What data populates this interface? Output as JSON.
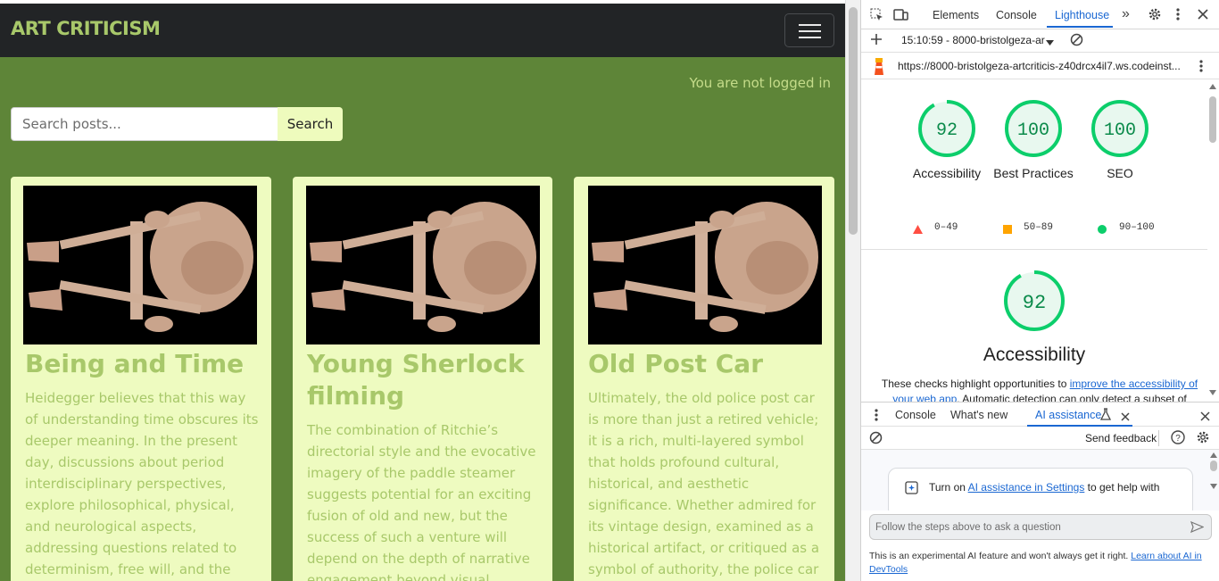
{
  "site": {
    "brand": "ART CRITICISM",
    "login_status": "You are not logged in",
    "search": {
      "placeholder": "Search posts...",
      "button": "Search"
    },
    "posts": [
      {
        "title": "Being and Time",
        "excerpt": "Heidegger believes that this way of understanding time obscures its deeper meaning. In the present day, discussions about period interdisciplinary perspectives, explore philosophical, physical, and neurological aspects, addressing questions related to determinism, free will, and the nature of temporal"
      },
      {
        "title": "Young Sherlock filming",
        "excerpt": "The combination of Ritchie’s directorial style and the evocative imagery of the paddle steamer suggests potential for an exciting fusion of old and new, but the success of such a venture will depend on the depth of narrative engagement beyond visual"
      },
      {
        "title": "Old Post Car",
        "excerpt": "Ultimately, the old police post car is more than just a retired vehicle; it is a rich, multi-layered symbol that holds profound cultural, historical, and aesthetic significance. Whether admired for its vintage design, examined as a historical artifact, or critiqued as a symbol of authority, the police car remains a powerful"
      }
    ]
  },
  "devtools": {
    "tabs": [
      "Elements",
      "Console",
      "Lighthouse"
    ],
    "active_tab": "Lighthouse",
    "overflow_label": "»",
    "report_select": "15:10:59 - 8000-bristolgeza-ar",
    "report_url": "https://8000-bristolgeza-artcriticis-z40drcx4il7.ws.codeinst...",
    "scores": [
      {
        "label": "Accessibility",
        "score": 92
      },
      {
        "label": "Best Practices",
        "score": 100
      },
      {
        "label": "SEO",
        "score": 100
      }
    ],
    "legend": [
      "0–49",
      "50–89",
      "90–100"
    ],
    "accessibility": {
      "score": 92,
      "title": "Accessibility",
      "desc_before": "These checks highlight opportunities to ",
      "desc_link": "improve the accessibility of your web app",
      "desc_after": ". Automatic detection can only detect a subset of"
    },
    "drawer_tabs": [
      "Console",
      "What's new",
      "AI assistance"
    ],
    "drawer_active": "AI assistance",
    "send_feedback": "Send feedback",
    "ai_card": {
      "before": "Turn on ",
      "link": "AI assistance in Settings",
      "after": " to get help with"
    },
    "ai_placeholder": "Follow the steps above to ask a question",
    "disclaimer": {
      "text": "This is an experimental AI feature and won't always get it right. ",
      "link": "Learn about AI in DevTools"
    },
    "colors": {
      "pass": "#0cce6b",
      "average": "#ffa400",
      "fail": "#ff4e42",
      "accent": "#1a67d2"
    }
  }
}
